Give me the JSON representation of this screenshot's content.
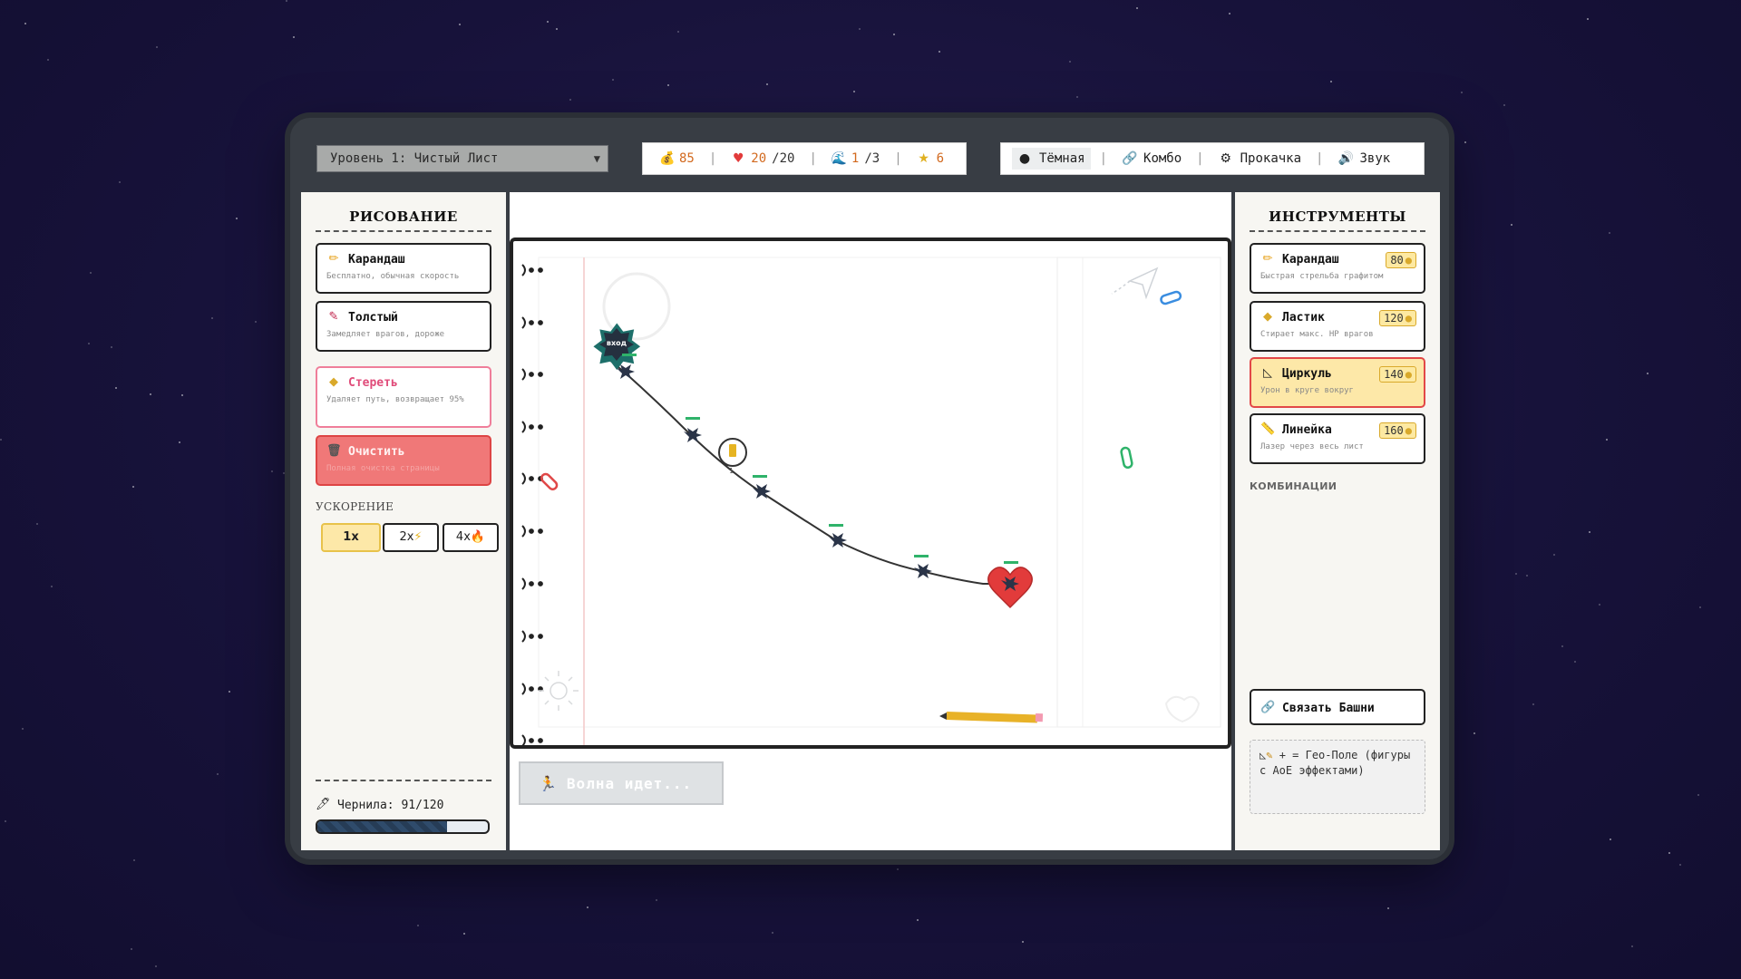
{
  "level_select": {
    "value": "Уровень 1: Чистый Лист"
  },
  "stats": {
    "coins": {
      "value": "85",
      "icon": "coin-bag-icon"
    },
    "lives": {
      "value": "20",
      "max": "/20",
      "icon": "heart-icon"
    },
    "wave": {
      "value": "1",
      "max": "/3",
      "icon": "wave-icon"
    },
    "stars": {
      "value": "6",
      "icon": "star-icon"
    }
  },
  "menu": {
    "theme": "Тёмная",
    "combo": "Комбо",
    "upgrade": "Прокачка",
    "sound": "Звук"
  },
  "left_panel": {
    "title": "РИСОВАНИЕ",
    "tools": [
      {
        "name": "Карандаш",
        "desc": "Бесплатно, обычная скорость"
      },
      {
        "name": "Толстый",
        "desc": "Замедляет врагов, дороже"
      },
      {
        "name": "Стереть",
        "desc": "Удаляет путь, возвращает 95%"
      },
      {
        "name": "Очистить",
        "desc": "Полная очистка страницы"
      }
    ],
    "speed_label": "УСКОРЕНИЕ",
    "speed": {
      "s1": "1x",
      "s2": "2x",
      "s4": "4x",
      "selected": "1x"
    },
    "ink_label": "Чернила: 91/120",
    "ink_fraction": 0.758
  },
  "right_panel": {
    "title": "ИНСТРУМЕНТЫ",
    "towers": [
      {
        "name": "Карандаш",
        "desc": "Быстрая стрельба графитом",
        "price": "80"
      },
      {
        "name": "Ластик",
        "desc": "Стирает макс. HP врагов",
        "price": "120"
      },
      {
        "name": "Циркуль",
        "desc": "Урон в круге вокруг",
        "price": "140"
      },
      {
        "name": "Линейка",
        "desc": "Лазер через весь лист",
        "price": "160"
      }
    ],
    "selected_tower": "Циркуль",
    "combos_label": "КОМБИНАЦИИ",
    "combo_button": "Связать Башни",
    "combo_info": "+ = Гео-Поле (фигуры с AoE эффектами)"
  },
  "board": {
    "entry_label": "вход",
    "tower_level": "1"
  },
  "wave_button": "Волна идет...",
  "colors": {
    "accent_orange": "#d2691e",
    "erase_pink": "#e04c7a",
    "clear_red": "#f07878",
    "selected_yellow": "#fde8a8",
    "enemy": "#2a3448",
    "heart_red": "#e23b3b"
  }
}
